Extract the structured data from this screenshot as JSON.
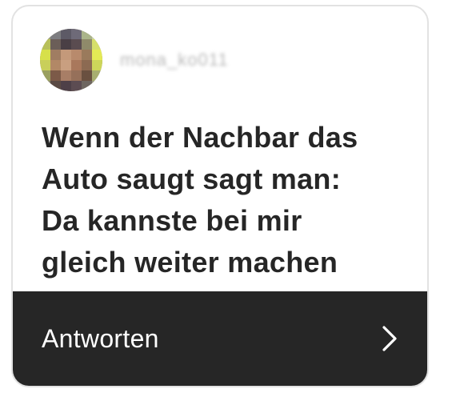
{
  "post": {
    "username": "mona_ko011",
    "message": "Wenn der Nachbar das\nAuto saugt sagt man:\nDa kannste bei mir\ngleich weiter machen",
    "avatar_icon": "pixelated-avatar-icon"
  },
  "reply": {
    "label": "Antworten",
    "icon": "chevron-right-icon"
  },
  "colors": {
    "card_border": "#e2e2e2",
    "text": "#262626",
    "reply_bar": "#262626",
    "reply_text": "#ffffff"
  }
}
